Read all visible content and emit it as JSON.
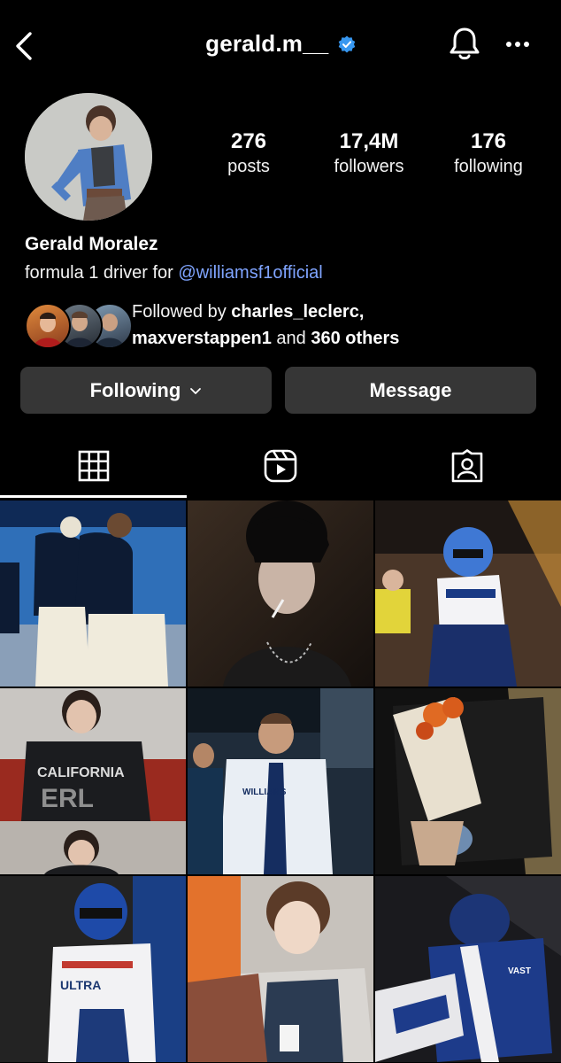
{
  "header": {
    "username": "gerald.m__",
    "verified": true,
    "back_icon": "chevron-left-icon",
    "notifications_icon": "bell-icon",
    "menu_icon": "more-horizontal-icon"
  },
  "profile": {
    "name": "Gerald Moralez",
    "bio_prefix": "formula 1 driver for ",
    "bio_link": "@williamsf1official",
    "stats": [
      {
        "value": "276",
        "label": "posts"
      },
      {
        "value": "17,4M",
        "label": "followers"
      },
      {
        "value": "176",
        "label": "following"
      }
    ]
  },
  "followed_by": {
    "prefix": "Followed by ",
    "user1": "charles_leclerc",
    "comma": ",",
    "user2": "maxverstappen1",
    "middle": " and ",
    "others": "360 others"
  },
  "actions": {
    "following_label": "Following",
    "message_label": "Message"
  },
  "tabs": [
    {
      "icon": "grid-icon",
      "active": true
    },
    {
      "icon": "reels-icon",
      "active": false
    },
    {
      "icon": "tagged-icon",
      "active": false
    }
  ],
  "colors": {
    "background": "#000000",
    "button": "#363636",
    "link": "#7fa4ff",
    "verified": "#3797f0"
  }
}
